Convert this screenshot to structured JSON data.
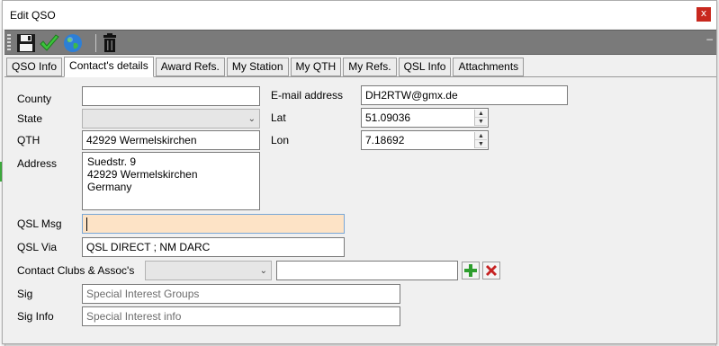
{
  "window": {
    "title": "Edit QSO",
    "close_label": "x"
  },
  "toolbar": {
    "menu_glyph": "–"
  },
  "tabs": [
    {
      "label": "QSO Info"
    },
    {
      "label": "Contact's details"
    },
    {
      "label": "Award Refs."
    },
    {
      "label": "My Station"
    },
    {
      "label": "My QTH"
    },
    {
      "label": "My Refs."
    },
    {
      "label": "QSL Info"
    },
    {
      "label": "Attachments"
    }
  ],
  "active_tab": "Contact's details",
  "form": {
    "county": {
      "label": "County",
      "value": ""
    },
    "state": {
      "label": "State",
      "value": ""
    },
    "qth": {
      "label": "QTH",
      "value": "42929 Wermelskirchen"
    },
    "address": {
      "label": "Address",
      "lines": [
        "Suedstr. 9",
        "42929 Wermelskirchen",
        "Germany"
      ]
    },
    "email": {
      "label": "E-mail address",
      "value": "DH2RTW@gmx.de"
    },
    "lat": {
      "label": "Lat",
      "value": "51.09036"
    },
    "lon": {
      "label": "Lon",
      "value": "7.18692"
    },
    "qsl_msg": {
      "label": "QSL Msg",
      "value": ""
    },
    "qsl_via": {
      "label": "QSL Via",
      "value": "QSL DIRECT ; NM DARC"
    },
    "clubs": {
      "label": "Contact Clubs & Assoc's",
      "select_value": "",
      "text_value": ""
    },
    "sig": {
      "label": "Sig",
      "placeholder": "Special Interest Groups"
    },
    "sig_info": {
      "label": "Sig Info",
      "placeholder": "Special Interest info"
    }
  },
  "colors": {
    "toolbar": "#7a7a7a",
    "close": "#c8281e",
    "highlight": "#fde3c6",
    "add": "#2e9e2e",
    "delete": "#c62222"
  }
}
